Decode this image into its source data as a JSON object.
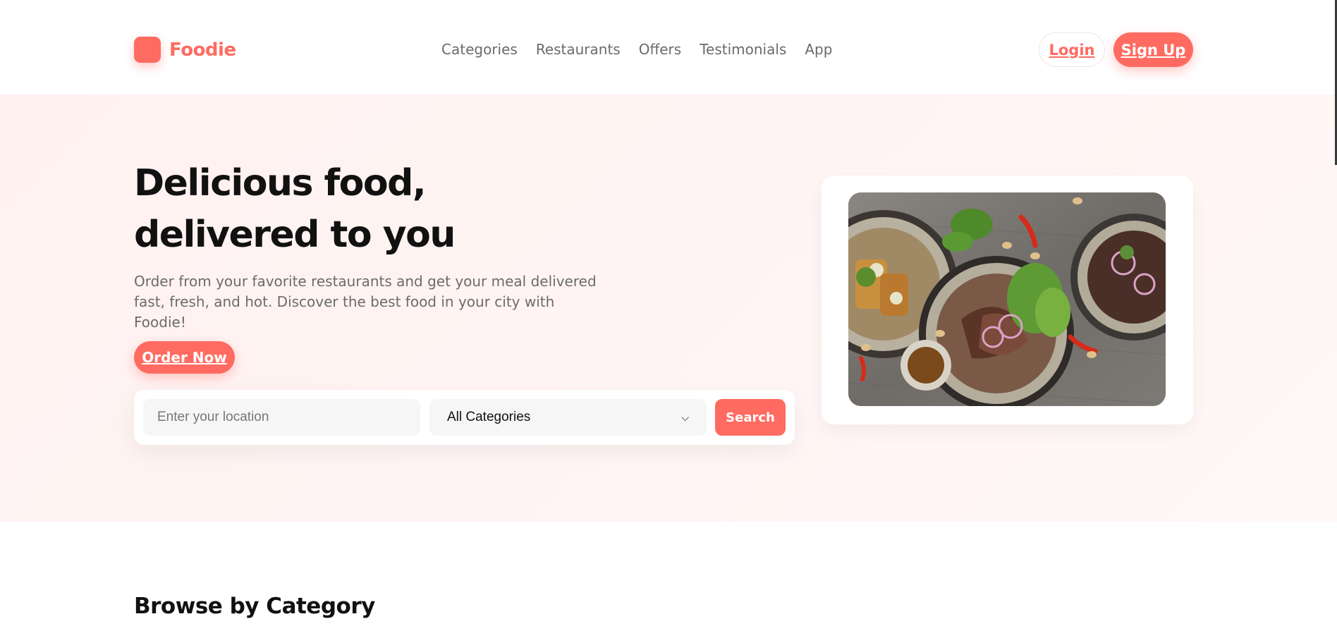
{
  "brand": {
    "name": "Foodie",
    "accent_color": "#ff6b61"
  },
  "nav": {
    "items": [
      {
        "label": "Categories"
      },
      {
        "label": "Restaurants"
      },
      {
        "label": "Offers"
      },
      {
        "label": "Testimonials"
      },
      {
        "label": "App"
      }
    ]
  },
  "auth": {
    "login_label": "Login",
    "signup_label": "Sign Up"
  },
  "hero": {
    "title": "Delicious food, delivered to you",
    "description": "Order from your favorite restaurants and get your meal delivered fast, fresh, and hot. Discover the best food in your city with Foodie!",
    "cta_label": "Order Now",
    "image_icon": "food-photo"
  },
  "search": {
    "location_placeholder": "Enter your location",
    "location_value": "",
    "category_selected": "All Categories",
    "search_label": "Search"
  },
  "categories_section": {
    "title": "Browse by Category"
  }
}
